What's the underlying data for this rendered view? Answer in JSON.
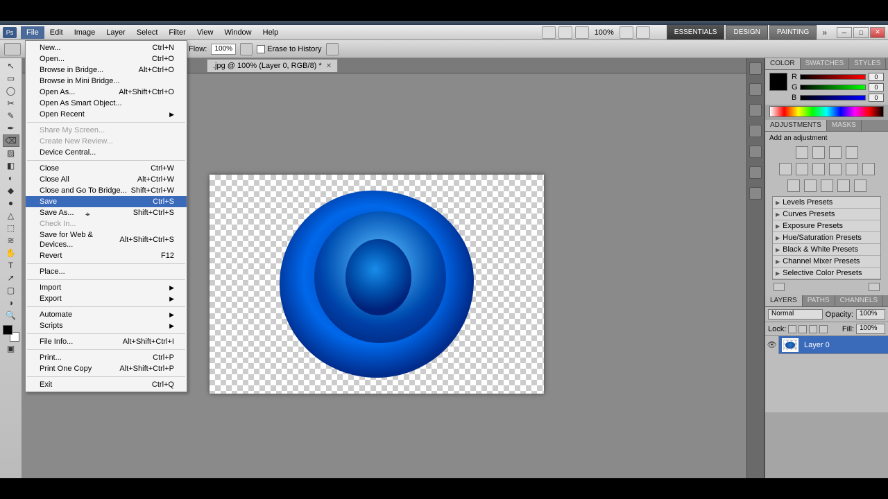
{
  "menubar": {
    "items": [
      "File",
      "Edit",
      "Image",
      "Layer",
      "Select",
      "Filter",
      "View",
      "Window",
      "Help"
    ],
    "active": "File"
  },
  "zoom": "100%",
  "workspace": {
    "buttons": [
      "ESSENTIALS",
      "DESIGN",
      "PAINTING"
    ],
    "active": "ESSENTIALS"
  },
  "optionsbar": {
    "flow_label": "Flow:",
    "flow_value": "100%",
    "erase_history": "Erase to History"
  },
  "doctab": {
    "title": ".jpg @ 100% (Layer 0, RGB/8) *"
  },
  "file_menu": [
    {
      "label": "New...",
      "shortcut": "Ctrl+N"
    },
    {
      "label": "Open...",
      "shortcut": "Ctrl+O"
    },
    {
      "label": "Browse in Bridge...",
      "shortcut": "Alt+Ctrl+O"
    },
    {
      "label": "Browse in Mini Bridge...",
      "shortcut": ""
    },
    {
      "label": "Open As...",
      "shortcut": "Alt+Shift+Ctrl+O"
    },
    {
      "label": "Open As Smart Object...",
      "shortcut": ""
    },
    {
      "label": "Open Recent",
      "shortcut": "",
      "submenu": true
    },
    {
      "sep": true
    },
    {
      "label": "Share My Screen...",
      "shortcut": "",
      "disabled": true
    },
    {
      "label": "Create New Review...",
      "shortcut": "",
      "disabled": true
    },
    {
      "label": "Device Central...",
      "shortcut": ""
    },
    {
      "sep": true
    },
    {
      "label": "Close",
      "shortcut": "Ctrl+W"
    },
    {
      "label": "Close All",
      "shortcut": "Alt+Ctrl+W"
    },
    {
      "label": "Close and Go To Bridge...",
      "shortcut": "Shift+Ctrl+W"
    },
    {
      "label": "Save",
      "shortcut": "Ctrl+S",
      "hover": true
    },
    {
      "label": "Save As...",
      "shortcut": "Shift+Ctrl+S",
      "cursor": true
    },
    {
      "label": "Check In...",
      "shortcut": "",
      "disabled": true
    },
    {
      "label": "Save for Web & Devices...",
      "shortcut": "Alt+Shift+Ctrl+S"
    },
    {
      "label": "Revert",
      "shortcut": "F12"
    },
    {
      "sep": true
    },
    {
      "label": "Place...",
      "shortcut": ""
    },
    {
      "sep": true
    },
    {
      "label": "Import",
      "shortcut": "",
      "submenu": true
    },
    {
      "label": "Export",
      "shortcut": "",
      "submenu": true
    },
    {
      "sep": true
    },
    {
      "label": "Automate",
      "shortcut": "",
      "submenu": true
    },
    {
      "label": "Scripts",
      "shortcut": "",
      "submenu": true
    },
    {
      "sep": true
    },
    {
      "label": "File Info...",
      "shortcut": "Alt+Shift+Ctrl+I"
    },
    {
      "sep": true
    },
    {
      "label": "Print...",
      "shortcut": "Ctrl+P"
    },
    {
      "label": "Print One Copy",
      "shortcut": "Alt+Shift+Ctrl+P"
    },
    {
      "sep": true
    },
    {
      "label": "Exit",
      "shortcut": "Ctrl+Q"
    }
  ],
  "panels": {
    "color": {
      "tabs": [
        "COLOR",
        "SWATCHES",
        "STYLES"
      ],
      "active": "COLOR",
      "r": "0",
      "g": "0",
      "b": "0"
    },
    "adjustments": {
      "tabs": [
        "ADJUSTMENTS",
        "MASKS"
      ],
      "active": "ADJUSTMENTS",
      "label": "Add an adjustment",
      "presets": [
        "Levels Presets",
        "Curves Presets",
        "Exposure Presets",
        "Hue/Saturation Presets",
        "Black & White Presets",
        "Channel Mixer Presets",
        "Selective Color Presets"
      ]
    },
    "layers": {
      "tabs": [
        "LAYERS",
        "PATHS",
        "CHANNELS"
      ],
      "active": "LAYERS",
      "blend": "Normal",
      "opacity_label": "Opacity:",
      "opacity": "100%",
      "lock_label": "Lock:",
      "fill_label": "Fill:",
      "fill": "100%",
      "layer0": "Layer 0"
    }
  },
  "tools": [
    "↖",
    "▭",
    "◯",
    "✂",
    "✎",
    "✒",
    "⌫",
    "▨",
    "◧",
    "◐",
    "◆",
    "●",
    "△",
    "⬚",
    "≋",
    "✋",
    "T",
    "↗",
    "▢",
    "◑",
    "🔍"
  ]
}
